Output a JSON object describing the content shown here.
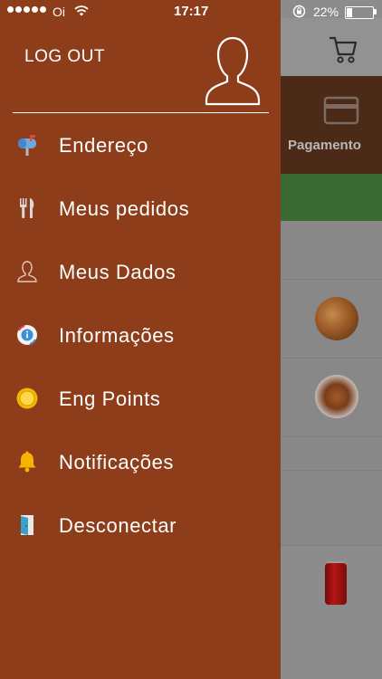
{
  "status_bar": {
    "carrier": "Oi",
    "time": "17:17",
    "battery": "22%",
    "battery_level": 0.22,
    "signal_bars_filled": 5
  },
  "drawer": {
    "logout_label": "LOG OUT",
    "avatar_icon": "user-silhouette-icon",
    "background_color": "#8e3d1a",
    "items": [
      {
        "label": "Endereço",
        "icon": "mailbox-icon"
      },
      {
        "label": "Meus pedidos",
        "icon": "fork-knife-icon"
      },
      {
        "label": "Meus Dados",
        "icon": "user-icon"
      },
      {
        "label": "Informações",
        "icon": "info-icon"
      },
      {
        "label": "Eng Points",
        "icon": "coin-icon"
      },
      {
        "label": "Notificações",
        "icon": "bell-icon"
      },
      {
        "label": "Desconectar",
        "icon": "door-icon"
      }
    ]
  },
  "background_app": {
    "cart_icon": "cart-icon",
    "payment_tab_label": "Pagamento",
    "payment_icon": "card-icon",
    "accent_green": "#3a6a31"
  }
}
